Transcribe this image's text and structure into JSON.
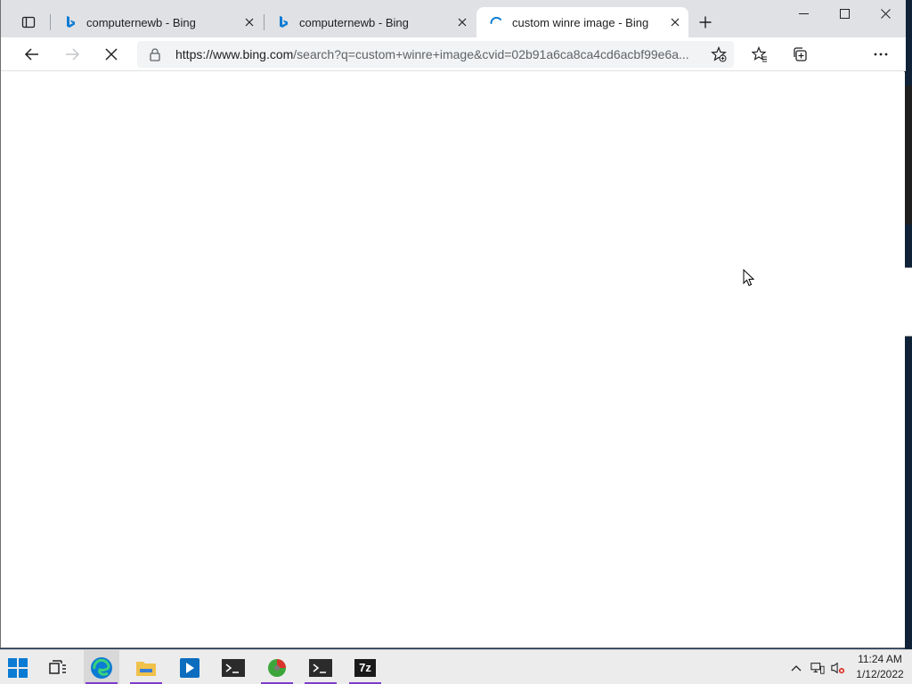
{
  "browser": {
    "tabs": [
      {
        "title": "computernewb - Bing",
        "favicon": "bing-icon",
        "active": false
      },
      {
        "title": "computernewb - Bing",
        "favicon": "bing-icon",
        "active": false
      },
      {
        "title": "custom winre image - Bing",
        "favicon": "loading-spinner-icon",
        "active": true
      }
    ],
    "address": {
      "domain": "https://www.bing.com",
      "rest": "/search?q=custom+winre+image&cvid=02b91a6ca8ca4cd6acbf99e6a..."
    },
    "loading": true
  },
  "taskbar": {
    "apps": [
      {
        "name": "start-button"
      },
      {
        "name": "task-view"
      },
      {
        "name": "microsoft-edge",
        "running": true,
        "active": true
      },
      {
        "name": "file-explorer",
        "running": true
      },
      {
        "name": "media-app"
      },
      {
        "name": "terminal"
      },
      {
        "name": "drive-tool",
        "running": true
      },
      {
        "name": "terminal-2",
        "running": true
      },
      {
        "name": "7-zip",
        "running": true,
        "label": "7z"
      }
    ],
    "clock": {
      "time": "11:24 AM",
      "date": "1/12/2022"
    }
  },
  "colors": {
    "accent": "#7d3cc9",
    "edge_blue": "#0c7bd3",
    "tab_strip": "#dfe1e5"
  }
}
